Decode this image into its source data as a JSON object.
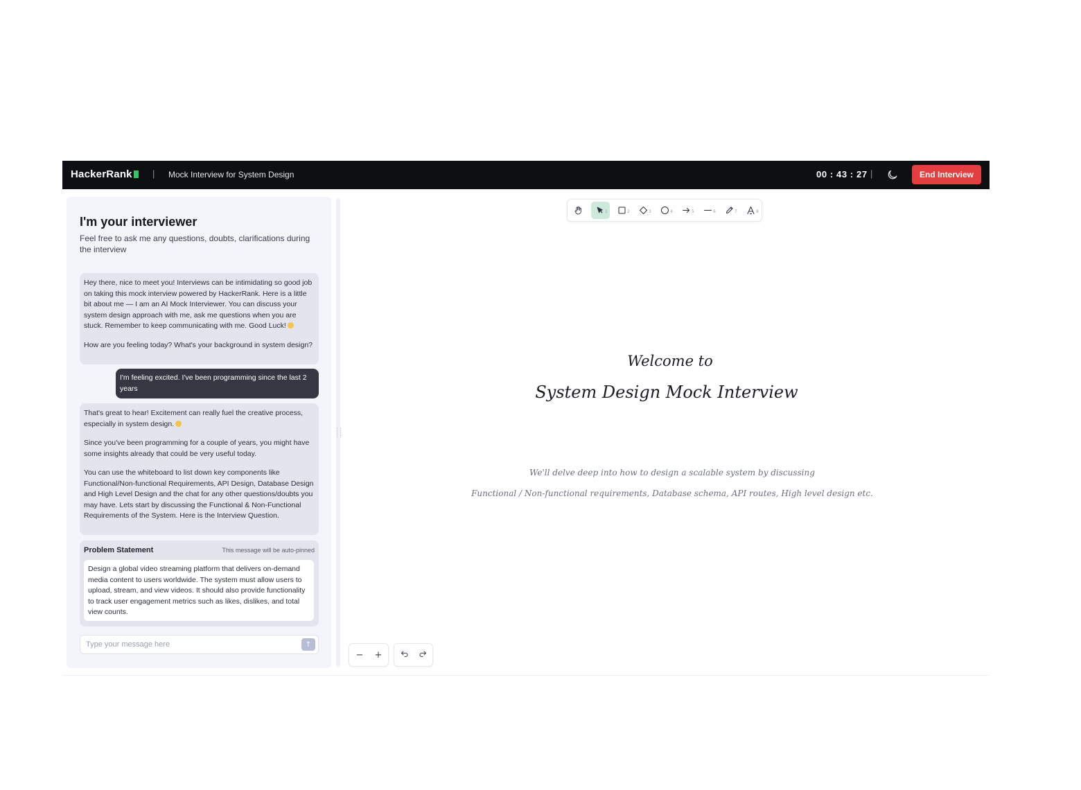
{
  "header": {
    "brand": "HackerRank",
    "separator": "|",
    "page_title": "Mock Interview for System Design",
    "timer": "00 : 43 : 27",
    "theme_icon": "moon-icon",
    "end_button_label": "End Interview",
    "end_button_color": "#e53e3e",
    "brand_accent_color": "#2ec866"
  },
  "chat": {
    "heading": "I'm your interviewer",
    "subheading": "Feel free to ask me any questions, doubts, clarifications during the interview",
    "messages": [
      {
        "role": "interviewer",
        "paragraphs": [
          "Hey there, nice to meet you! Interviews can be intimidating so good job on taking this mock interview powered by HackerRank. Here is a little bit about me — I am an AI Mock Interviewer. You can discuss your system design approach with me, ask me questions when you are stuck. Remember to keep communicating with me. Good Luck!",
          "How are you feeling today? What's your background in system design?"
        ]
      },
      {
        "role": "candidate",
        "paragraphs": [
          "I'm feeling excited. I've been programming since the last 2 years"
        ]
      },
      {
        "role": "interviewer",
        "paragraphs": [
          "That's great to hear! Excitement can really fuel the creative process, especially in system design.",
          "Since you've been programming for a couple of years, you might have some insights already that could be very useful today.",
          "You can use the whiteboard to list down key components like Functional/Non-functional Requirements, API Design, Database Design and High Level Design and the chat for any other questions/doubts you may have. Lets start by discussing the Functional & Non-Functional Requirements of the System. Here is the Interview Question."
        ]
      }
    ],
    "problem": {
      "title": "Problem Statement",
      "note": "This message will be auto-pinned",
      "body": "Design a global video streaming platform that delivers on-demand media content to users worldwide. The system must allow users to upload, stream, and view videos. It should also provide functionality to track user engagement metrics such as likes, dislikes, and total view counts."
    },
    "composer": {
      "placeholder": "Type your message here",
      "value": "",
      "send_icon": "arrow-up-icon"
    }
  },
  "toolbar": {
    "tools": [
      {
        "name": "hand",
        "icon": "hand-icon",
        "key": ""
      },
      {
        "name": "selection",
        "icon": "pointer-icon",
        "key": "1",
        "active": true
      },
      {
        "name": "rectangle",
        "icon": "rectangle-icon",
        "key": "2"
      },
      {
        "name": "diamond",
        "icon": "diamond-icon",
        "key": "3"
      },
      {
        "name": "ellipse",
        "icon": "circle-icon",
        "key": "4"
      },
      {
        "name": "arrow",
        "icon": "arrow-icon",
        "key": "5"
      },
      {
        "name": "line",
        "icon": "line-icon",
        "key": "6"
      },
      {
        "name": "draw",
        "icon": "pencil-icon",
        "key": "7"
      },
      {
        "name": "text",
        "icon": "text-icon",
        "key": "8"
      }
    ],
    "active_color": "#cde9db"
  },
  "canvas": {
    "welcome": "Welcome to",
    "title": "System Design Mock Interview",
    "description_line1": "We'll delve deep into how to design a scalable system by discussing",
    "description_line2": "Functional / Non-functional requirements, Database schema, API routes, High level design etc."
  },
  "controls": {
    "zoom_out": "−",
    "zoom_in": "+",
    "undo_icon": "undo-icon",
    "redo_icon": "redo-icon"
  }
}
